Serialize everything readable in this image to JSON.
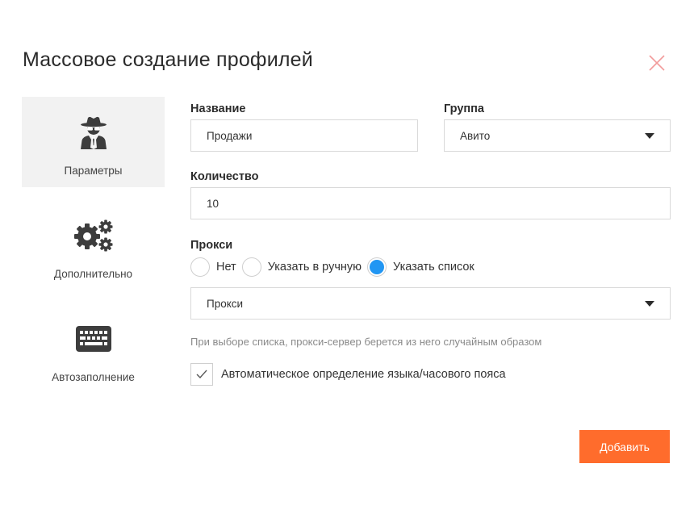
{
  "dialog": {
    "title": "Массовое создание профилей"
  },
  "sidebar": {
    "items": [
      {
        "label": "Параметры",
        "icon": "spy-icon",
        "active": true
      },
      {
        "label": "Дополнительно",
        "icon": "gears-icon",
        "active": false
      },
      {
        "label": "Автозаполнение",
        "icon": "keyboard-icon",
        "active": false
      }
    ]
  },
  "form": {
    "name": {
      "label": "Название",
      "value": "Продажи"
    },
    "group": {
      "label": "Группа",
      "value": "Авито"
    },
    "quantity": {
      "label": "Количество",
      "value": "10"
    },
    "proxy": {
      "label": "Прокси",
      "options": [
        {
          "label": "Нет",
          "checked": false
        },
        {
          "label": "Указать в ручную",
          "checked": false
        },
        {
          "label": "Указать список",
          "checked": true
        }
      ],
      "select_value": "Прокси",
      "hint": "При выборе списка, прокси-сервер берется из него случайным образом"
    },
    "auto_detect": {
      "label": "Автоматическое определение языка/часового пояса",
      "checked": true
    },
    "submit_label": "Добавить"
  },
  "colors": {
    "accent": "#ff6c2c",
    "radio_selected": "#2196f3",
    "close": "#f29b9b",
    "sidebar_active": "#f2f2f2"
  }
}
